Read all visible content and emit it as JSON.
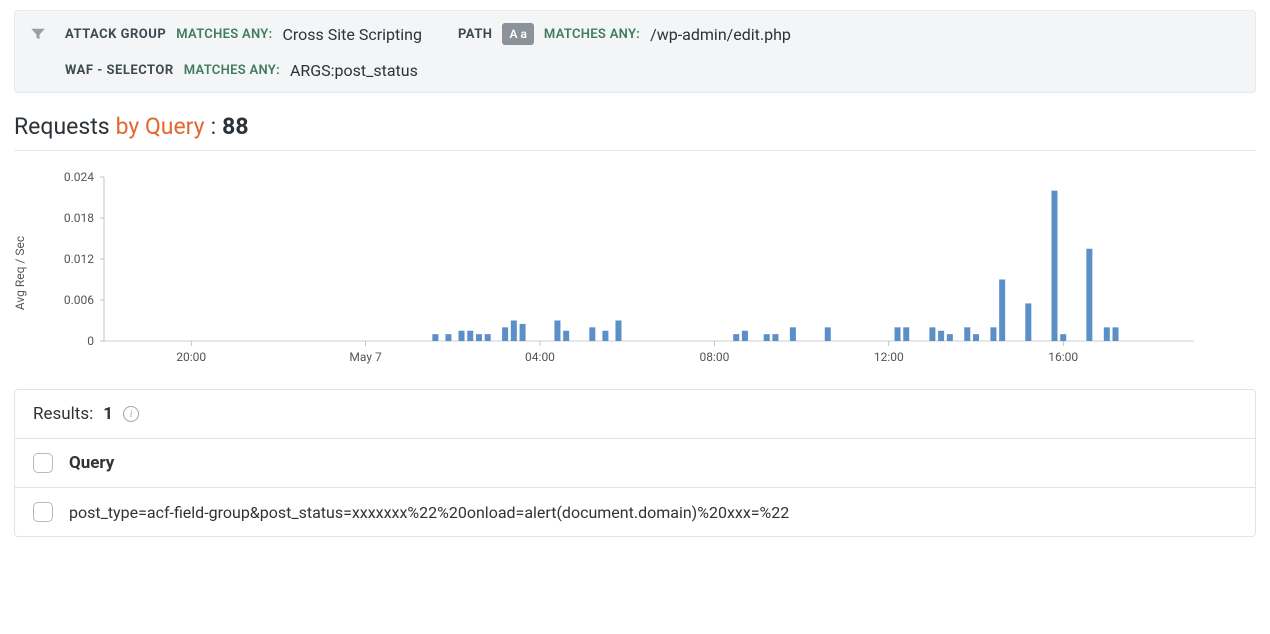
{
  "filters": [
    {
      "label": "ATTACK GROUP",
      "op": "MATCHES ANY:",
      "value": "Cross Site Scripting",
      "case_badge": null
    },
    {
      "label": "PATH",
      "op": "MATCHES ANY:",
      "value": "/wp-admin/edit.php",
      "case_badge": "A a"
    },
    {
      "label": "WAF - SELECTOR",
      "op": "MATCHES ANY:",
      "value": "ARGS:post_status",
      "case_badge": null
    }
  ],
  "heading": {
    "prefix": "Requests",
    "accent": "by Query",
    "sep": ":",
    "count": "88"
  },
  "chart": {
    "ylabel": "Avg Req / Sec"
  },
  "results": {
    "label": "Results:",
    "count": "1",
    "column": "Query",
    "rows": [
      "post_type=acf-field-group&post_status=xxxxxxx%22%20onload=alert(document.domain)%20xxx=%22"
    ]
  },
  "chart_data": {
    "type": "bar",
    "title": "Requests by Query : 88",
    "ylabel": "Avg Req / Sec",
    "xlabel": "",
    "ylim": [
      0,
      0.024
    ],
    "y_ticks": [
      0,
      0.006,
      0.012,
      0.018,
      0.024
    ],
    "x_tick_labels": [
      "20:00",
      "May 7",
      "04:00",
      "08:00",
      "12:00",
      "16:00"
    ],
    "x_tick_positions_hours": [
      2,
      6,
      10,
      14,
      18,
      22
    ],
    "x_range_hours": [
      0,
      25
    ],
    "series": [
      {
        "name": "Avg Req / Sec",
        "points": [
          {
            "x": 7.6,
            "y": 0.001
          },
          {
            "x": 7.9,
            "y": 0.001
          },
          {
            "x": 8.2,
            "y": 0.0015
          },
          {
            "x": 8.4,
            "y": 0.0015
          },
          {
            "x": 8.6,
            "y": 0.001
          },
          {
            "x": 8.8,
            "y": 0.001
          },
          {
            "x": 9.2,
            "y": 0.002
          },
          {
            "x": 9.4,
            "y": 0.003
          },
          {
            "x": 9.6,
            "y": 0.0025
          },
          {
            "x": 10.4,
            "y": 0.003
          },
          {
            "x": 10.6,
            "y": 0.0015
          },
          {
            "x": 11.2,
            "y": 0.002
          },
          {
            "x": 11.5,
            "y": 0.0015
          },
          {
            "x": 11.8,
            "y": 0.003
          },
          {
            "x": 14.5,
            "y": 0.001
          },
          {
            "x": 14.7,
            "y": 0.0015
          },
          {
            "x": 15.2,
            "y": 0.001
          },
          {
            "x": 15.4,
            "y": 0.001
          },
          {
            "x": 15.8,
            "y": 0.002
          },
          {
            "x": 16.6,
            "y": 0.002
          },
          {
            "x": 18.2,
            "y": 0.002
          },
          {
            "x": 18.4,
            "y": 0.002
          },
          {
            "x": 19.0,
            "y": 0.002
          },
          {
            "x": 19.2,
            "y": 0.0015
          },
          {
            "x": 19.4,
            "y": 0.001
          },
          {
            "x": 19.8,
            "y": 0.002
          },
          {
            "x": 20.0,
            "y": 0.001
          },
          {
            "x": 20.4,
            "y": 0.002
          },
          {
            "x": 20.6,
            "y": 0.009
          },
          {
            "x": 21.2,
            "y": 0.0055
          },
          {
            "x": 21.8,
            "y": 0.022
          },
          {
            "x": 22.0,
            "y": 0.001
          },
          {
            "x": 22.6,
            "y": 0.0135
          },
          {
            "x": 23.0,
            "y": 0.002
          },
          {
            "x": 23.2,
            "y": 0.002
          }
        ]
      }
    ]
  }
}
